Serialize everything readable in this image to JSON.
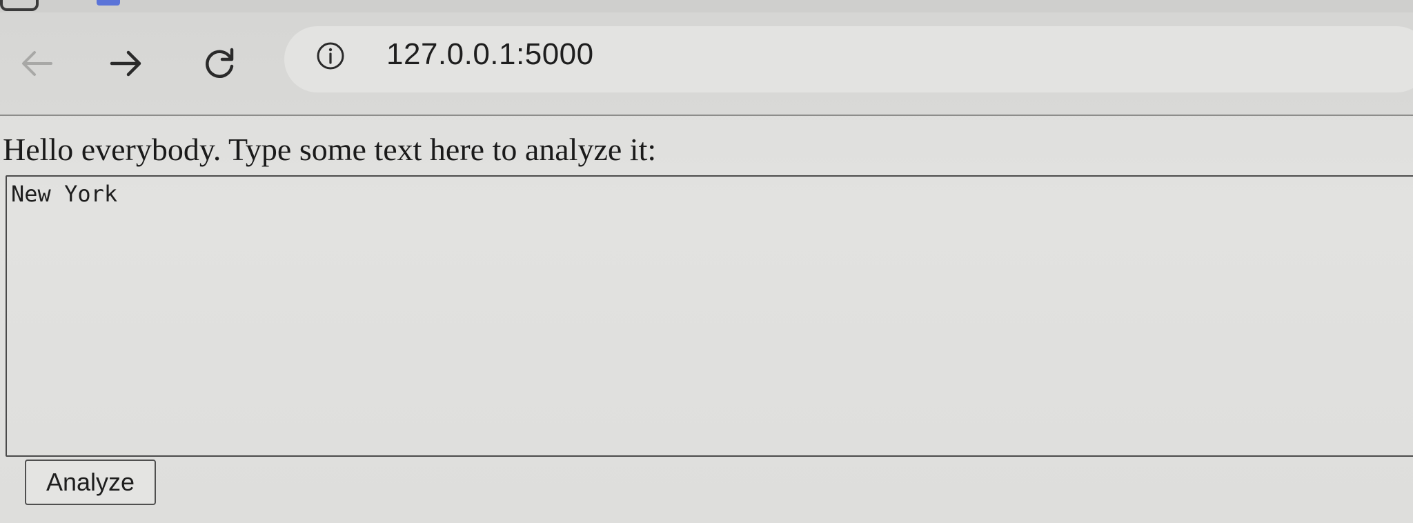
{
  "browser": {
    "nav": {
      "back_icon": "arrow-left-icon",
      "forward_icon": "arrow-right-icon",
      "reload_icon": "reload-icon"
    },
    "address_bar": {
      "info_icon": "info-icon",
      "url": "127.0.0.1:5000"
    }
  },
  "page": {
    "prompt": "Hello everybody. Type some text here to analyze it:",
    "textarea_value": "New York",
    "button_label": "Analyze"
  }
}
